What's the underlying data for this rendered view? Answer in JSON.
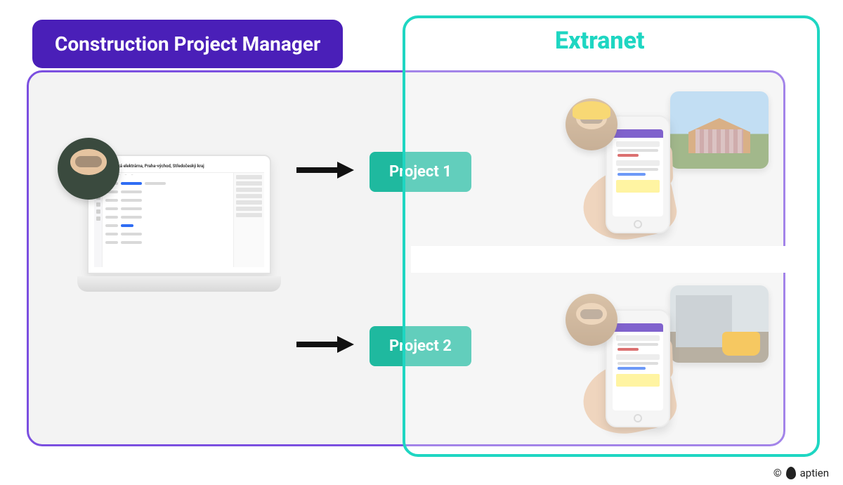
{
  "headers": {
    "left": "Construction Project Manager",
    "right": "Extranet"
  },
  "projects": {
    "one": "Project  1",
    "two": "Project 2"
  },
  "laptop": {
    "screen_title": "Fotovoltaická elektrárna, Praha-východ, Středočeský kraj"
  },
  "footer": {
    "copyright": "©",
    "brand": "aptien"
  },
  "colors": {
    "purple": "#4a1fb8",
    "teal_border": "#1ed6c2",
    "badge": "#1fb99f"
  }
}
